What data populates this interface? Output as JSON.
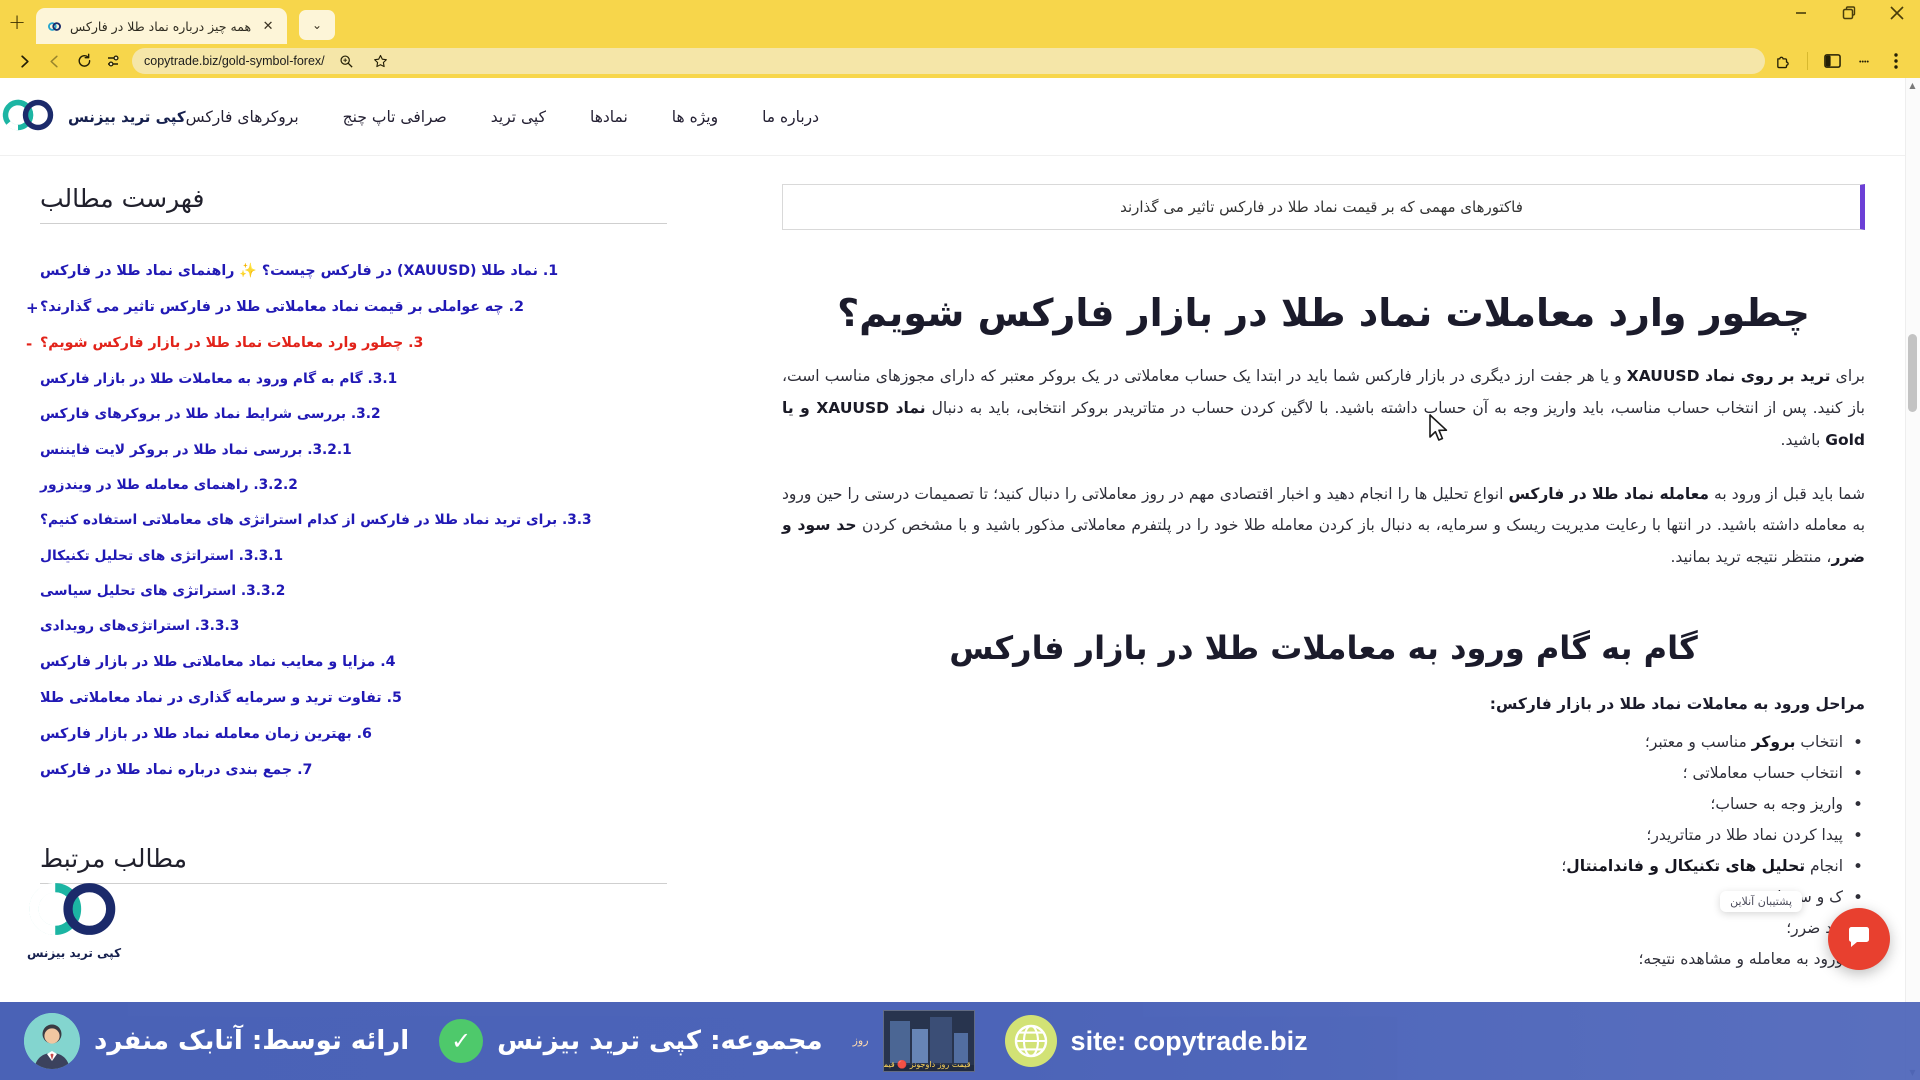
{
  "browser": {
    "tab": {
      "title": "همه چیز درباره نماد طلا در فارکس",
      "favicon_name": "copytrade-favicon",
      "close_label": "✕"
    },
    "new_tab_label": "+",
    "tab_list_label": "⌄",
    "window_controls": {
      "close": "✕",
      "restore": "❐",
      "minimize": "—"
    },
    "toolbar": {
      "menu_label": "⋮",
      "profile_label": "",
      "sidebar_label": "",
      "extensions_label": "",
      "bookmark_label": "☆",
      "zoom_label": "⌕",
      "url": "copytrade.biz/gold-symbol-forex/",
      "site_settings_label": "",
      "reload_label": "⟳",
      "back_label": "←",
      "forward_label": "→"
    }
  },
  "site": {
    "brand": {
      "name": "کپی ترید بیزنس",
      "logo_name": "copytrade-business-logo",
      "color_primary": "#1cb5a3",
      "color_secondary": "#1b2a6b"
    },
    "nav": [
      {
        "label": "بروکرهای فارکس"
      },
      {
        "label": "صرافی تاپ چنج"
      },
      {
        "label": "کپی ترید"
      },
      {
        "label": "نمادها"
      },
      {
        "label": "ویژه ها"
      },
      {
        "label": "درباره ما"
      }
    ]
  },
  "main": {
    "notice": {
      "text": "فاکتورهای مهمی که بر قیمت نماد طلا در فارکس تاثیر می گذارند",
      "accent_color": "#6c3fd6"
    },
    "section_title": "چطور وارد معاملات نماد طلا در بازار فارکس شویم؟",
    "paragraph1": {
      "part_a": "برای ",
      "bold_a": "ترید بر روی نماد XAUUSD",
      "part_b": " و یا هر جفت ارز دیگری در بازار فارکس شما باید در ابتدا یک حساب معاملاتی در یک بروکر معتبر که دارای مجوزهای مناسب است، باز کنید. پس از انتخاب حساب مناسب، باید واریز وجه به آن حساب داشته باشید. با لاگین کردن حساب در متاتریدر بروکر انتخابی، باید به دنبال ",
      "bold_b": "نماد XAUUSD و یا Gold",
      "part_c": " باشید."
    },
    "paragraph2": {
      "part_a": "شما باید قبل از ورود به ",
      "bold_a": "معامله نماد طلا در فارکس",
      "part_b": " انواع تحلیل ها را انجام دهید و اخبار اقتصادی مهم در روز معاملاتی را دنبال کنید؛ تا تصمیمات درستی را حین ورود به معامله داشته باشید. در انتها با رعایت مدیریت ریسک و سرمایه، به دنبال باز کردن معامله طلا خود را در پلتفرم معاملاتی مذکور باشید و با مشخص کردن ",
      "bold_b": "حد سود و ضرر",
      "part_c": "، منتظر نتیجه ترید بمانید."
    },
    "sub_title": "گام به گام ورود به معاملات طلا در بازار فارکس",
    "lead": "مراحل ورود به معاملات نماد طلا در بازار فارکس:",
    "steps": [
      {
        "pre": "انتخاب ",
        "bold": "بروکر",
        "post": " مناسب و معتبر؛"
      },
      {
        "pre": "انتخاب حساب معاملاتی ؛",
        "bold": "",
        "post": ""
      },
      {
        "pre": "واریز وجه به حساب؛",
        "bold": "",
        "post": ""
      },
      {
        "pre": "پیدا کردن نماد طلا در متاتریدر؛",
        "bold": "",
        "post": ""
      },
      {
        "pre": "انجام ",
        "bold": "تحلیل های تکنیکال و فاندامنتال",
        "post": "؛"
      },
      {
        "pre": "ک و سرمایه؛",
        "bold": "",
        "post": ""
      },
      {
        "pre": "حد ضرر؛",
        "bold": "",
        "post": ""
      },
      {
        "pre": "ورود به معامله و مشاهده نتیجه؛",
        "bold": "",
        "post": ""
      }
    ]
  },
  "sidebar": {
    "toc_heading": "فهرست مطالب",
    "related_heading": "مطالب مرتبط",
    "toc": [
      {
        "level": 1,
        "text": "1. نماد طلا (XAUUSD) در فارکس چیست؟ ✨ راهنمای نماد طلا در فارکس",
        "toggle": "",
        "active": false
      },
      {
        "level": 1,
        "text": "2. چه عواملی بر قیمت نماد معاملاتی طلا در فارکس تاثیر می گذارند؟",
        "toggle": "+",
        "active": false
      },
      {
        "level": 1,
        "text": "3. چطور وارد معاملات نماد طلا در بازار فارکس شویم؟",
        "toggle": "-",
        "active": true
      },
      {
        "level": 2,
        "text": "3.1. گام به گام ورود به معاملات طلا در بازار فارکس",
        "toggle": "",
        "active": false
      },
      {
        "level": 2,
        "text": "3.2. بررسی شرایط نماد طلا در بروکرهای فارکس",
        "toggle": "",
        "active": false
      },
      {
        "level": 3,
        "text": "3.2.1. بررسی نماد طلا در بروکر لایت فایننس",
        "toggle": "",
        "active": false
      },
      {
        "level": 3,
        "text": "3.2.2. راهنمای معامله طلا در ویندزور",
        "toggle": "",
        "active": false
      },
      {
        "level": 2,
        "text": "3.3. برای ترید نماد طلا در فارکس از کدام استراتژی های معاملاتی استفاده کنیم؟",
        "toggle": "",
        "active": false
      },
      {
        "level": 3,
        "text": "3.3.1. استراتژی های تحلیل تکنیکال",
        "toggle": "",
        "active": false
      },
      {
        "level": 3,
        "text": "3.3.2. استراتژی های تحلیل سیاسی",
        "toggle": "",
        "active": false
      },
      {
        "level": 3,
        "text": "3.3.3. استراتژی‌های رویدادی",
        "toggle": "",
        "active": false
      },
      {
        "level": 1,
        "text": "4. مزایا و معایب نماد معاملاتی طلا در بازار فارکس",
        "toggle": "",
        "active": false
      },
      {
        "level": 1,
        "text": "5. تفاوت ترید و سرمایه گذاری در نماد معاملاتی طلا",
        "toggle": "",
        "active": false
      },
      {
        "level": 1,
        "text": "6. بهترین زمان معامله نماد طلا در بازار فارکس",
        "toggle": "",
        "active": false
      },
      {
        "level": 1,
        "text": "7. جمع بندی درباره نماد طلا در فارکس",
        "toggle": "",
        "active": false
      }
    ]
  },
  "watermark": {
    "brand_name": "کپی ترید بیزنس"
  },
  "chat": {
    "tooltip": "پشتیبان آنلاین",
    "icon_name": "chat-bubble-icon"
  },
  "overlay": {
    "presenter_label": "ارائه توسط: آتابک منفرد",
    "collection_label": "مجموعه: کپی ترید بیزنس",
    "site_label": "site: copytrade.biz",
    "thumb_caption": "قیمت روز داوجونز 🔴 قیمت زنده داوجونز را از کجا",
    "thumb_side": "روز",
    "check_glyph": "✓"
  },
  "scrollbar": {
    "up_arrow": "▲",
    "down_arrow": "▼"
  }
}
